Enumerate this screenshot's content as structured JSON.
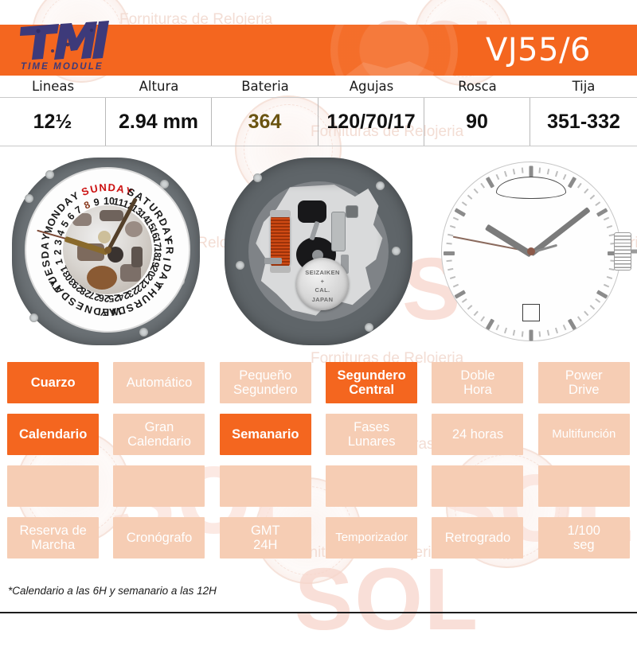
{
  "brand": {
    "logo_text": "TMI",
    "logo_subtitle": "TIME MODULE",
    "logo_color": "#3d3a7a",
    "header_color": "#f4661f"
  },
  "header": {
    "title": "VJ55/6"
  },
  "spec_table": {
    "headers": [
      "Lineas",
      "Altura",
      "Bateria",
      "Agujas",
      "Rosca",
      "Tija"
    ],
    "values": [
      "12½",
      "2.94 mm",
      "364",
      "120/70/17",
      "90",
      "351-332"
    ],
    "battery_value_color": "#6b5411"
  },
  "images": {
    "dial_day_date": {
      "name": "day-date-disc-photo",
      "weekdays": [
        "SUNDAY",
        "SATURDAY",
        "FRIDAY",
        "THURSDAY",
        "WEDNESDAY",
        "TUESDAY",
        "MONDAY"
      ],
      "highlight_day": "SUNDAY",
      "highlight_day_color": "#cc1111",
      "dates": [
        "10",
        "11",
        "12",
        "13",
        "14",
        "15",
        "16",
        "17",
        "18",
        "19",
        "20",
        "21",
        "22",
        "23",
        "24",
        "25",
        "26",
        "27",
        "28",
        "29",
        "30",
        "31",
        "1",
        "2",
        "3",
        "4",
        "5",
        "6",
        "7",
        "8",
        "9"
      ],
      "highlight_date": "8",
      "highlight_date_color": "#8a3b1f"
    },
    "movement_back": {
      "name": "movement-back-photo",
      "battery_text_top": "SEIZAIKEN",
      "battery_text_mid": "+",
      "battery_text_cal": "CAL.",
      "battery_text_bottom": "JAPAN",
      "plate_color": "#6c7276",
      "coil_color": "#cf4a14"
    },
    "dial_front": {
      "name": "dial-front-photo",
      "has_day_window": true,
      "has_date_window": true,
      "has_crown": true
    }
  },
  "features": {
    "rows": [
      [
        {
          "label": "Cuarzo",
          "active": true
        },
        {
          "label": "Automático",
          "active": false
        },
        {
          "label": "Pequeño\nSegundero",
          "active": false
        },
        {
          "label": "Segundero\nCentral",
          "active": true
        },
        {
          "label": "Doble\nHora",
          "active": false
        },
        {
          "label": "Power\nDrive",
          "active": false
        }
      ],
      [
        {
          "label": "Calendario",
          "active": true
        },
        {
          "label": "Gran\nCalendario",
          "active": false
        },
        {
          "label": "Semanario",
          "active": true
        },
        {
          "label": "Fases\nLunares",
          "active": false
        },
        {
          "label": "24 horas",
          "active": false
        },
        {
          "label": "Multifunción",
          "active": false
        }
      ],
      [
        {
          "label": "",
          "active": false
        },
        {
          "label": "",
          "active": false
        },
        {
          "label": "",
          "active": false
        },
        {
          "label": "",
          "active": false
        },
        {
          "label": "",
          "active": false
        },
        {
          "label": "",
          "active": false
        }
      ],
      [
        {
          "label": "Reserva de\nMarcha",
          "active": false
        },
        {
          "label": "Cronógrafo",
          "active": false
        },
        {
          "label": "GMT\n24H",
          "active": false
        },
        {
          "label": "Temporizador",
          "active": false
        },
        {
          "label": "Retrogrado",
          "active": false
        },
        {
          "label": "1/100\nseg",
          "active": false
        }
      ]
    ],
    "active_color": "#f4661f",
    "inactive_color": "#f6cdb4"
  },
  "footnote": "*Calendario a las 6H y semanario a las 12H",
  "watermark": {
    "sol_text": "SOL",
    "tagline": "Fornituras de Relojeria"
  }
}
